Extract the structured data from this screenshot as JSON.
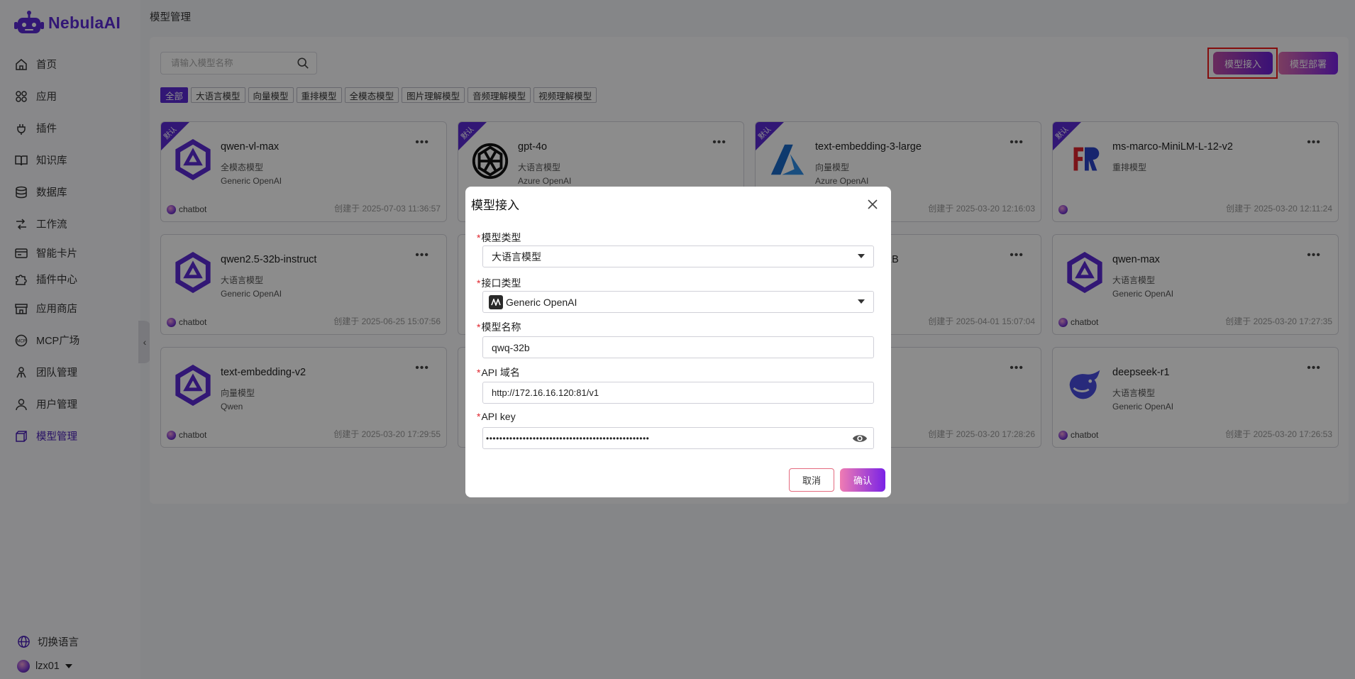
{
  "app": {
    "name": "NebulaAI"
  },
  "sidebar": {
    "items": [
      {
        "label": "首页",
        "icon": "home-icon"
      },
      {
        "label": "应用",
        "icon": "apps-icon"
      },
      {
        "label": "插件",
        "icon": "plugin-icon"
      },
      {
        "label": "知识库",
        "icon": "book-icon"
      },
      {
        "label": "数据库",
        "icon": "database-icon"
      },
      {
        "label": "工作流",
        "icon": "workflow-icon"
      },
      {
        "label": "智能卡片",
        "icon": "card-icon"
      },
      {
        "label": "插件中心",
        "icon": "puzzle-icon"
      },
      {
        "label": "应用商店",
        "icon": "store-icon"
      },
      {
        "label": "MCP广场",
        "icon": "mcp-icon"
      },
      {
        "label": "团队管理",
        "icon": "team-icon"
      },
      {
        "label": "用户管理",
        "icon": "user-icon"
      },
      {
        "label": "模型管理",
        "icon": "model-icon",
        "active": true
      }
    ],
    "language_label": "切换语言",
    "username": "lzx01"
  },
  "page": {
    "title": "模型管理",
    "search_placeholder": "请输入模型名称",
    "access_button": "模型接入",
    "deploy_button": "模型部署"
  },
  "filters": [
    "全部",
    "大语言模型",
    "向量模型",
    "重排模型",
    "全模态模型",
    "图片理解模型",
    "音频理解模型",
    "视频理解模型"
  ],
  "cards": [
    {
      "ribbon": "默认",
      "title": "qwen-vl-max",
      "type": "全模态模型",
      "provider": "Generic OpenAI",
      "owner": "chatbot",
      "date": "创建于 2025-07-03 11:36:57"
    },
    {
      "ribbon": "默认",
      "title": "gpt-4o",
      "type": "大语言模型",
      "provider": "Azure OpenAI",
      "owner": "",
      "date": ""
    },
    {
      "ribbon": "默认",
      "title": "text-embedding-3-large",
      "type": "向量模型",
      "provider": "Azure OpenAI",
      "owner": "",
      "date": "创建于 2025-03-20 12:16:03"
    },
    {
      "ribbon": "默认",
      "title": "ms-marco-MiniLM-L-12-v2",
      "type": "重排模型",
      "provider": "",
      "owner": "",
      "date": "创建于 2025-03-20 12:11:24"
    },
    {
      "ribbon": "",
      "title": "qwen2.5-32b-instruct",
      "type": "大语言模型",
      "provider": "Generic OpenAI",
      "owner": "chatbot",
      "date": "创建于 2025-06-25 15:07:56"
    },
    {
      "ribbon": "",
      "title": "2B",
      "type": "",
      "provider": "",
      "owner": "",
      "date": "创建于 2025-04-01 15:07:04"
    },
    {
      "ribbon": "",
      "title": "qwen-max",
      "type": "大语言模型",
      "provider": "Generic OpenAI",
      "owner": "chatbot",
      "date": "创建于 2025-03-20 17:27:35"
    },
    {
      "ribbon": "",
      "title": "text-embedding-v2",
      "type": "向量模型",
      "provider": "Qwen",
      "owner": "chatbot",
      "date": "创建于 2025-03-20 17:29:55"
    },
    {
      "ribbon": "",
      "title": "",
      "type": "",
      "provider": "",
      "owner": "",
      "date": "创建于 2025-03-20 17:28:26"
    },
    {
      "ribbon": "",
      "title": "deepseek-r1",
      "type": "大语言模型",
      "provider": "Generic OpenAI",
      "owner": "chatbot",
      "date": "创建于 2025-03-20 17:26:53"
    }
  ],
  "modal": {
    "title": "模型接入",
    "fields": {
      "model_type": {
        "label": "模型类型",
        "value": "大语言模型"
      },
      "api_type": {
        "label": "接口类型",
        "value": "Generic OpenAI"
      },
      "model_name": {
        "label": "模型名称",
        "value": "qwq-32b"
      },
      "api_domain": {
        "label": "API 域名",
        "value": "http://172.16.16.120:81/v1"
      },
      "api_key": {
        "label": "API key",
        "value": "•••••••••••••••••••••••••••••••••••••••••••••••••"
      }
    },
    "cancel": "取消",
    "confirm": "确认"
  },
  "colors": {
    "accent": "#5b2bd6",
    "highlight": "#f01818",
    "required": "#e0262e"
  }
}
